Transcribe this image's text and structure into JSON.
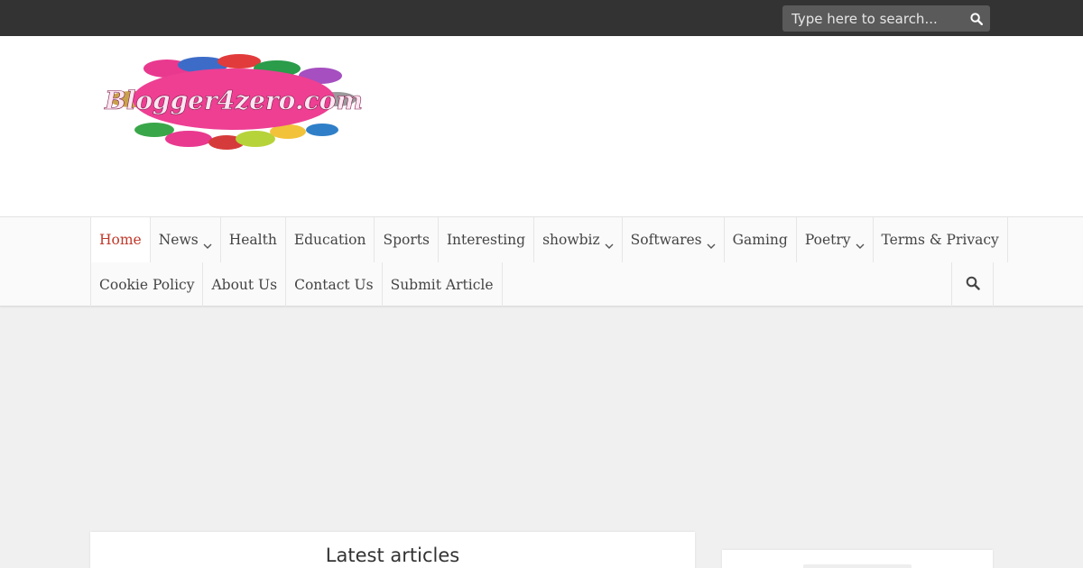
{
  "topbar": {
    "search_placeholder": "Type here to search...",
    "search_icon": "search-icon"
  },
  "header": {
    "logo_text": "Blogger4zero.com"
  },
  "nav": {
    "row1": [
      {
        "label": "Home",
        "active": true,
        "dropdown": false
      },
      {
        "label": "News",
        "active": false,
        "dropdown": true
      },
      {
        "label": "Health",
        "active": false,
        "dropdown": false
      },
      {
        "label": "Education",
        "active": false,
        "dropdown": false
      },
      {
        "label": "Sports",
        "active": false,
        "dropdown": false
      },
      {
        "label": "Interesting",
        "active": false,
        "dropdown": false
      },
      {
        "label": "showbiz",
        "active": false,
        "dropdown": true
      },
      {
        "label": "Softwares",
        "active": false,
        "dropdown": true
      },
      {
        "label": "Gaming",
        "active": false,
        "dropdown": false
      },
      {
        "label": "Poetry",
        "active": false,
        "dropdown": true
      },
      {
        "label": "Terms & Privacy",
        "active": false,
        "dropdown": false
      }
    ],
    "row2": [
      {
        "label": "Cookie Policy",
        "active": false,
        "dropdown": false
      },
      {
        "label": "About Us",
        "active": false,
        "dropdown": false
      },
      {
        "label": "Contact Us",
        "active": false,
        "dropdown": false
      },
      {
        "label": "Submit Article",
        "active": false,
        "dropdown": false
      }
    ],
    "search_icon": "search-icon"
  },
  "main": {
    "section_title": "Latest articles"
  },
  "colors": {
    "topbar": "#333333",
    "active_nav": "#c0392b",
    "logo_pink": "#e8398f"
  }
}
